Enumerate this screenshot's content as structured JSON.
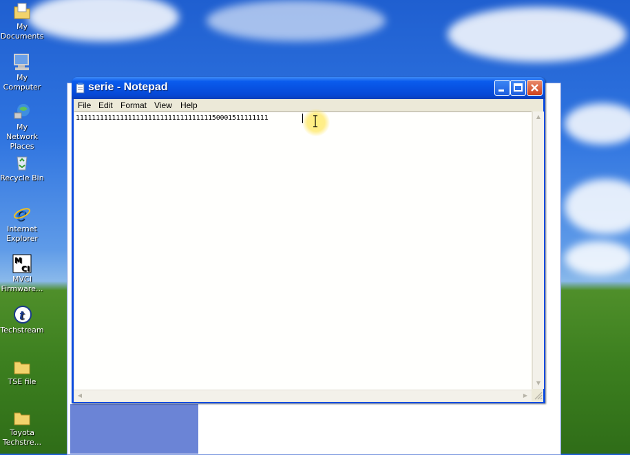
{
  "desktop": {
    "icons": [
      {
        "label1": "My",
        "label2": "Documents",
        "icon": "folder-documents-icon"
      },
      {
        "label1": "My",
        "label2": "Computer",
        "icon": "computer-icon"
      },
      {
        "label1": "My Network",
        "label2": "Places",
        "icon": "network-icon"
      },
      {
        "label1": "Recycle Bin",
        "label2": "",
        "icon": "recycle-bin-icon"
      },
      {
        "label1": "Internet",
        "label2": "Explorer",
        "icon": "internet-explorer-icon"
      },
      {
        "label1": "MVCI",
        "label2": "Firmware...",
        "icon": "mvci-icon"
      },
      {
        "label1": "Techstream",
        "label2": "",
        "icon": "techstream-icon"
      },
      {
        "label1": "TSE file",
        "label2": "",
        "icon": "folder-icon"
      },
      {
        "label1": "Toyota",
        "label2": "Techstre...",
        "icon": "folder-icon"
      }
    ]
  },
  "notepad": {
    "title": "serie - Notepad",
    "menu": [
      "File",
      "Edit",
      "Format",
      "View",
      "Help"
    ],
    "content": "111111111111111111111111111111111150001511111111",
    "colors": {
      "titlebar": "#0a5bed",
      "close": "#d0431d",
      "edit_bg": "#fffffd"
    }
  }
}
